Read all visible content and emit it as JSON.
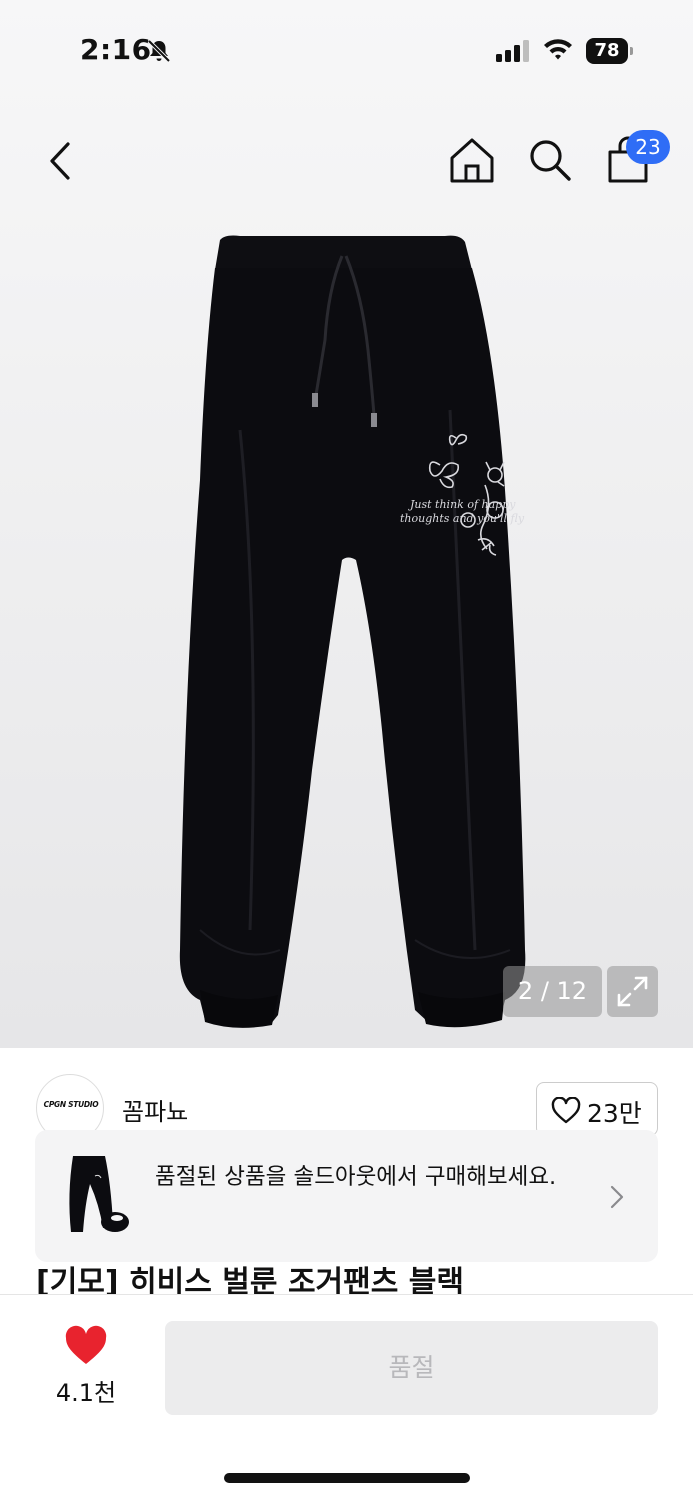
{
  "status_bar": {
    "time": "2:16",
    "battery": "78"
  },
  "header": {
    "cart_count": "23"
  },
  "gallery": {
    "counter": "2 / 12",
    "print_text": "Just think of happy thoughts and you'll fly"
  },
  "seller": {
    "logo_text": "CPGN STUDIO",
    "name": "꼼파뇨",
    "likes": "23만"
  },
  "soldout_banner": {
    "text": "품절된 상품을 솔드아웃에서 구매해보세요."
  },
  "product": {
    "title": "[기모] 히비스 벌룬 조거팬츠 블랙"
  },
  "bottom_bar": {
    "wish_count": "4.1천",
    "buy_label": "품절"
  },
  "colors": {
    "accent_badge": "#2f6df6",
    "wish_heart": "#e8232e",
    "disabled_button": "#ececed"
  },
  "icons": [
    "back-icon",
    "home-icon",
    "search-icon",
    "bag-icon",
    "expand-icon",
    "heart-outline-icon",
    "chevron-right-icon",
    "heart-filled-icon"
  ]
}
